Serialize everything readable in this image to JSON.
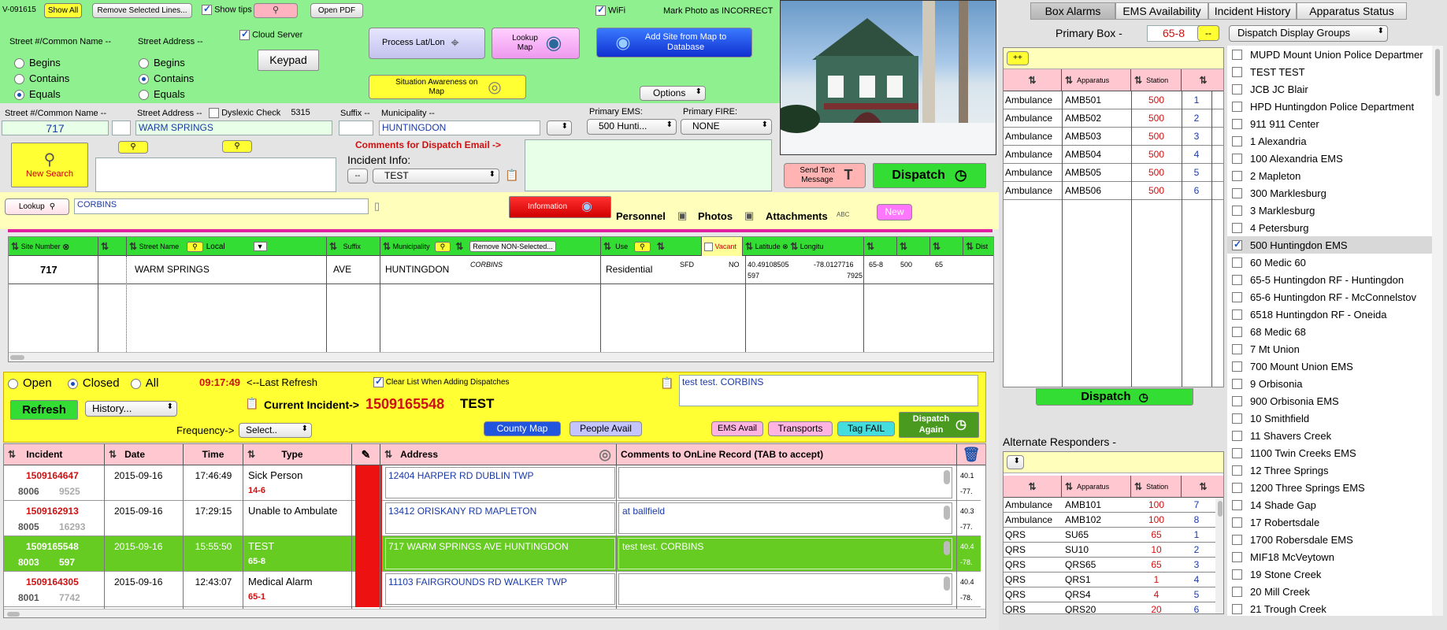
{
  "toolbar": {
    "version": "V-091615",
    "show_all": "Show All",
    "remove_selected_lines": "Remove Selected Lines...",
    "show_tips": "Show tips",
    "open_pdf": "Open PDF",
    "wifi": "WiFi",
    "mark_photo": "Mark Photo as INCORRECT"
  },
  "search_mode": {
    "common_name_label": "Street #/Common Name --",
    "street_address_label": "Street Address --",
    "options_left": [
      "Begins",
      "Contains",
      "Equals"
    ],
    "options_right": [
      "Begins",
      "Contains",
      "Equals"
    ],
    "cloud_server": "Cloud Server",
    "keypad": "Keypad",
    "process_latlon": "Process Lat/Lon",
    "lookup_map": "Lookup Map",
    "add_site": "Add Site from Map to Database",
    "situation_awareness": "Situation Awareness on Map",
    "options": "Options"
  },
  "address_entry": {
    "street_num_label": "Street #/Common Name --",
    "street_num_value": "717",
    "street_address_label": "Street Address --",
    "street_address_value": "WARM SPRINGS",
    "dyslexic_check": "Dyslexic Check",
    "dyslexic_count": "5315",
    "suffix_label": "Suffix --",
    "municipality_label": "Municipality --",
    "municipality_value": "HUNTINGDON",
    "primary_ems_label": "Primary EMS:",
    "primary_ems_value": "500 Hunti...",
    "primary_fire_label": "Primary FIRE:",
    "primary_fire_value": "NONE",
    "comments_email_label": "Comments for Dispatch Email ->",
    "incident_info_label": "Incident Info:",
    "incident_info_dash": "--",
    "incident_info_value": "TEST",
    "new_search": "New Search"
  },
  "lookup": {
    "lookup_btn": "Lookup",
    "lookup_value": "CORBINS",
    "information": "Information",
    "personnel": "Personnel",
    "photos": "Photos",
    "attachments": "Attachments",
    "new": "New"
  },
  "dispatch_panel": {
    "send_text": "Send Text Message",
    "dispatch": "Dispatch"
  },
  "site_grid": {
    "headers": {
      "site_number": "Site Number",
      "street_name": "Street Name",
      "local": "Local",
      "suffix": "Suffix",
      "municipality": "Municipality",
      "remove_non_selected": "Remove NON-Selected...",
      "use": "Use",
      "vacant": "Vacant",
      "latitude": "Latitude",
      "longitude": "Longitu",
      "dist": "Dist"
    },
    "row": {
      "site_number": "717",
      "street_name": "WARM SPRINGS",
      "suffix": "AVE",
      "municipality": "HUNTINGDON",
      "common_name": "CORBINS",
      "use": "Residential",
      "sfd": "SFD",
      "no": "NO",
      "latitude": "40.49108505",
      "lat2": "597",
      "longitude": "-78.0127716",
      "lon2": "7925",
      "box": "65-8",
      "ems": "500",
      "fire": "65"
    }
  },
  "incident_controls": {
    "open": "Open",
    "closed": "Closed",
    "all": "All",
    "time": "09:17:49",
    "last_refresh": "<--Last Refresh",
    "clear_list": "Clear List When Adding Dispatches",
    "refresh": "Refresh",
    "history": "History...",
    "current_incident_label": "Current Incident->",
    "current_incident_num": "1509165548",
    "current_incident_type": "TEST",
    "frequency_label": "Frequency->",
    "frequency_value": "Select..",
    "county_map": "County Map",
    "people_avail": "People Avail",
    "ems_avail": "EMS Avail",
    "transports": "Transports",
    "tag_fail": "Tag FAIL",
    "dispatch_again": "Dispatch Again",
    "comment_text": "test test.  CORBINS"
  },
  "incident_table": {
    "headers": {
      "incident": "Incident",
      "date": "Date",
      "time": "Time",
      "type": "Type",
      "address": "Address",
      "comments": "Comments to OnLine Record (TAB to accept)"
    },
    "rows": [
      {
        "incident": "1509164647",
        "sub1": "8006",
        "sub2": "9525",
        "date": "2015-09-16",
        "time": "17:46:49",
        "type": "Sick Person",
        "box": "14-6",
        "address": "12404 HARPER RD   DUBLIN TWP",
        "comment": "",
        "lat": "40.1",
        "lon": "-77."
      },
      {
        "incident": "1509162913",
        "sub1": "8005",
        "sub2": "16293",
        "date": "2015-09-16",
        "time": "17:29:15",
        "type": "Unable to Ambulate",
        "box": "",
        "address": "13412 ORISKANY RD   MAPLETON",
        "comment": "at ballfield",
        "lat": "40.3",
        "lon": "-77."
      },
      {
        "incident": "1509165548",
        "sub1": "8003",
        "sub2": "597",
        "date": "2015-09-16",
        "time": "15:55:50",
        "type": "TEST",
        "box": "65-8",
        "address": "717 WARM SPRINGS AVE   HUNTINGDON",
        "comment": "test test.  CORBINS",
        "lat": "40.4",
        "lon": "-78."
      },
      {
        "incident": "1509164305",
        "sub1": "8001",
        "sub2": "7742",
        "date": "2015-09-16",
        "time": "12:43:07",
        "type": "Medical Alarm",
        "box": "65-1",
        "address": "11103 FAIRGROUNDS RD   WALKER TWP",
        "comment": "",
        "lat": "40.4",
        "lon": "-78."
      }
    ]
  },
  "right_panel": {
    "tabs": [
      "Box Alarms",
      "EMS Availability",
      "Incident History",
      "Apparatus Status"
    ],
    "primary_box_label": "Primary Box -",
    "primary_box_value": "65-8",
    "dash_btn": "--",
    "plus_btn": "++",
    "display_groups": "Dispatch Display Groups",
    "apparatus_header": "Apparatus",
    "station_header": "Station",
    "primary_units": [
      {
        "type": "Ambulance",
        "app": "AMB501",
        "st": "500",
        "n": "1"
      },
      {
        "type": "Ambulance",
        "app": "AMB502",
        "st": "500",
        "n": "2"
      },
      {
        "type": "Ambulance",
        "app": "AMB503",
        "st": "500",
        "n": "3"
      },
      {
        "type": "Ambulance",
        "app": "AMB504",
        "st": "500",
        "n": "4"
      },
      {
        "type": "Ambulance",
        "app": "AMB505",
        "st": "500",
        "n": "5"
      },
      {
        "type": "Ambulance",
        "app": "AMB506",
        "st": "500",
        "n": "6"
      }
    ],
    "dispatch": "Dispatch",
    "alternate_label": "Alternate Responders -",
    "alt_units": [
      {
        "type": "Ambulance",
        "app": "AMB101",
        "st": "100",
        "n": "7"
      },
      {
        "type": "Ambulance",
        "app": "AMB102",
        "st": "100",
        "n": "8"
      },
      {
        "type": "QRS",
        "app": "SU65",
        "st": "65",
        "n": "1"
      },
      {
        "type": "QRS",
        "app": "SU10",
        "st": "10",
        "n": "2"
      },
      {
        "type": "QRS",
        "app": "QRS65",
        "st": "65",
        "n": "3"
      },
      {
        "type": "QRS",
        "app": "QRS1",
        "st": "1",
        "n": "4"
      },
      {
        "type": "QRS",
        "app": "QRS4",
        "st": "4",
        "n": "5"
      },
      {
        "type": "QRS",
        "app": "QRS20",
        "st": "20",
        "n": "6"
      }
    ],
    "groups": [
      {
        "label": "MUPD  Mount Union Police Departmer",
        "checked": false
      },
      {
        "label": "TEST  TEST",
        "checked": false
      },
      {
        "label": "JCB  JC Blair",
        "checked": false
      },
      {
        "label": "HPD  Huntingdon Police Department",
        "checked": false
      },
      {
        "label": "911  911 Center",
        "checked": false
      },
      {
        "label": "1  Alexandria",
        "checked": false
      },
      {
        "label": "100  Alexandria EMS",
        "checked": false
      },
      {
        "label": "2  Mapleton",
        "checked": false
      },
      {
        "label": "300  Marklesburg",
        "checked": false
      },
      {
        "label": "3  Marklesburg",
        "checked": false
      },
      {
        "label": "4  Petersburg",
        "checked": false
      },
      {
        "label": "500  Huntingdon EMS",
        "checked": true
      },
      {
        "label": "60  Medic 60",
        "checked": false
      },
      {
        "label": "65-5  Huntingdon RF - Huntingdon",
        "checked": false
      },
      {
        "label": "65-6  Huntingdon RF - McConnelstov",
        "checked": false
      },
      {
        "label": "6518  Huntingdon RF - Oneida",
        "checked": false
      },
      {
        "label": "68  Medic 68",
        "checked": false
      },
      {
        "label": "7  Mt Union",
        "checked": false
      },
      {
        "label": "700  Mount Union EMS",
        "checked": false
      },
      {
        "label": "9  Orbisonia",
        "checked": false
      },
      {
        "label": "900  Orbisonia EMS",
        "checked": false
      },
      {
        "label": "10  Smithfield",
        "checked": false
      },
      {
        "label": "11  Shavers Creek",
        "checked": false
      },
      {
        "label": "1100  Twin Creeks EMS",
        "checked": false
      },
      {
        "label": "12  Three Springs",
        "checked": false
      },
      {
        "label": "1200  Three Springs EMS",
        "checked": false
      },
      {
        "label": "14  Shade Gap",
        "checked": false
      },
      {
        "label": "17  Robertsdale",
        "checked": false
      },
      {
        "label": "1700  Robersdale EMS",
        "checked": false
      },
      {
        "label": "MIF18  McVeytown",
        "checked": false
      },
      {
        "label": "19  Stone Creek",
        "checked": false
      },
      {
        "label": "20  Mill Creek",
        "checked": false
      },
      {
        "label": "21  Trough Creek",
        "checked": false
      }
    ]
  }
}
